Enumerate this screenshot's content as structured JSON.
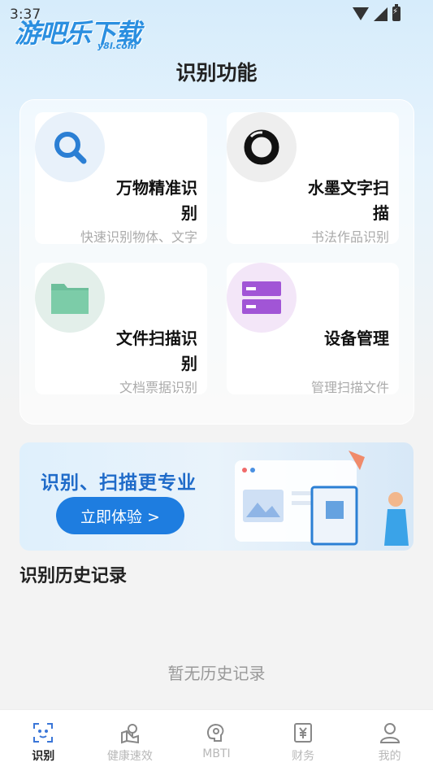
{
  "status_bar": {
    "time": "3:37"
  },
  "watermark": {
    "main": "游吧乐下载",
    "sub": "y8l.com"
  },
  "page_title": "识别功能",
  "features": [
    {
      "title": "万物精准识别",
      "subtitle": "快速识别物体、文字",
      "icon": "search-icon",
      "icon_bg": "#e8f1fa",
      "icon_color": "#2b7fd4"
    },
    {
      "title": "水墨文字扫描",
      "subtitle": "书法作品识别",
      "icon": "ink-circle-icon",
      "icon_bg": "#eeeeee",
      "icon_color": "#111111"
    },
    {
      "title": "文件扫描识别",
      "subtitle": "文档票据识别",
      "icon": "folder-icon",
      "icon_bg": "#e3efea",
      "icon_color": "#6dbf9b"
    },
    {
      "title": "设备管理",
      "subtitle": "管理扫描文件",
      "icon": "device-list-icon",
      "icon_bg": "#f3e6f8",
      "icon_color": "#a155d6"
    }
  ],
  "banner": {
    "headline": "识别、扫描更专业",
    "button": "立即体验 >"
  },
  "history": {
    "title": "识别历史记录",
    "empty": "暂无历史记录"
  },
  "nav": [
    {
      "label": "识别",
      "icon": "scan-face-icon",
      "active": true
    },
    {
      "label": "健康速效",
      "icon": "location-pin-icon",
      "active": false
    },
    {
      "label": "MBTI",
      "icon": "brain-icon",
      "active": false
    },
    {
      "label": "财务",
      "icon": "yen-receipt-icon",
      "active": false
    },
    {
      "label": "我的",
      "icon": "person-icon",
      "active": false
    }
  ],
  "colors": {
    "accent": "#1e7de0",
    "page_bg": "#f3f3f3"
  }
}
